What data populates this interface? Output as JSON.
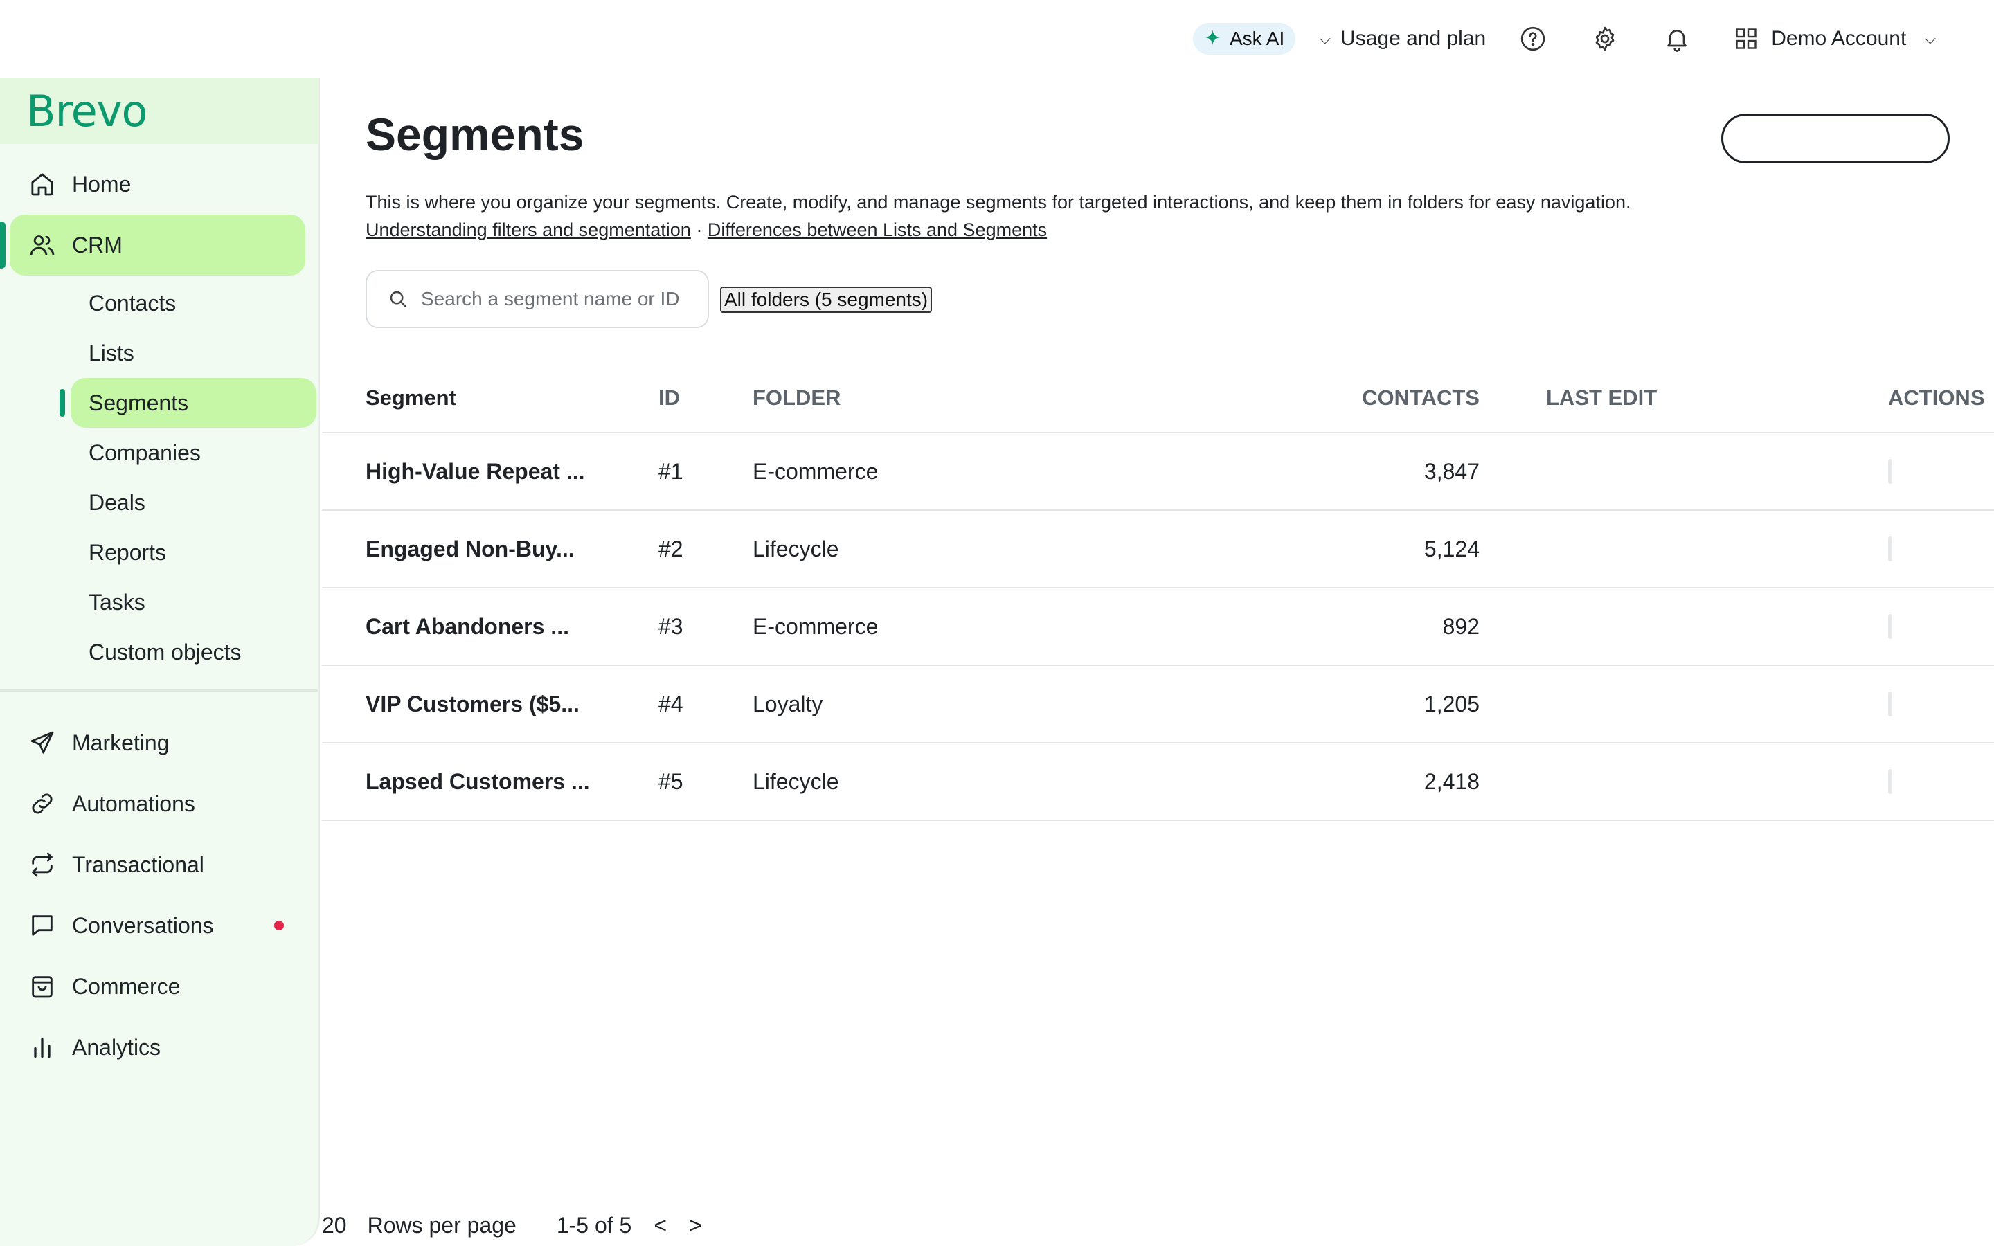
{
  "topbar": {
    "ask_ai_label": "Ask AI",
    "usage_label": "Usage and plan",
    "account_label": "Demo Account"
  },
  "sidebar": {
    "logo": "Brevo",
    "home": "Home",
    "crm": "CRM",
    "crm_items": [
      "Contacts",
      "Lists",
      "Segments",
      "Companies",
      "Deals",
      "Reports",
      "Tasks",
      "Custom objects"
    ],
    "marketing": "Marketing",
    "automations": "Automations",
    "transactional": "Transactional",
    "conversations": "Conversations",
    "commerce": "Commerce",
    "analytics": "Analytics"
  },
  "page": {
    "title": "Segments",
    "description": "This is where you organize your segments. Create, modify, and manage segments for targeted interactions, and keep them in folders for easy navigation.",
    "link1": "Understanding filters and segmentation",
    "separator": "·",
    "link2": "Differences between Lists and Segments",
    "search_placeholder": "Search a segment name or ID",
    "folders_button": "All folders (5 segments)"
  },
  "table": {
    "headers": [
      "Segment",
      "ID",
      "FOLDER",
      "CONTACTS",
      "LAST EDIT",
      "ACTIONS"
    ],
    "rows": [
      {
        "segment": "High-Value Repeat ...",
        "id": "#1",
        "folder": "E-commerce",
        "contacts": "3,847"
      },
      {
        "segment": "Engaged Non-Buy...",
        "id": "#2",
        "folder": "Lifecycle",
        "contacts": "5,124"
      },
      {
        "segment": "Cart Abandoners ...",
        "id": "#3",
        "folder": "E-commerce",
        "contacts": "892"
      },
      {
        "segment": "VIP Customers ($5...",
        "id": "#4",
        "folder": "Loyalty",
        "contacts": "1,205"
      },
      {
        "segment": "Lapsed Customers ...",
        "id": "#5",
        "folder": "Lifecycle",
        "contacts": "2,418"
      }
    ]
  },
  "pagination": {
    "rows_per_page_value": "20",
    "rows_per_page_label": "Rows per page",
    "range": "1-5 of 5",
    "prev": "<",
    "next": ">"
  },
  "colors": {
    "brand": "#0b996e",
    "active_bg": "#c5f7a7",
    "sidebar_bg": "#f1fbf1",
    "notification": "#e3274b"
  }
}
